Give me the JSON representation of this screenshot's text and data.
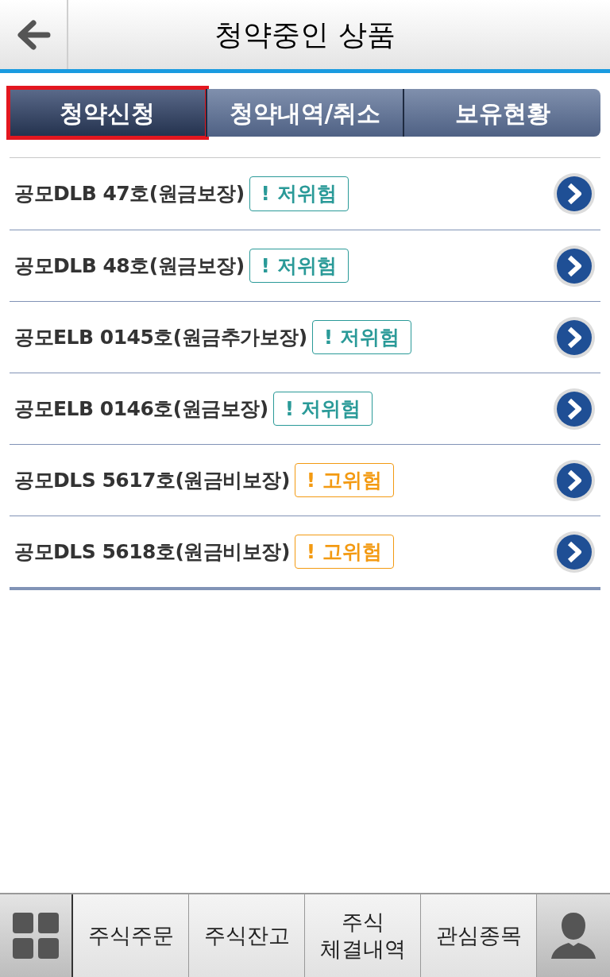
{
  "header": {
    "title": "청약중인 상품"
  },
  "tabs": [
    {
      "label": "청약신청",
      "selected": true
    },
    {
      "label": "청약내역/취소",
      "selected": false
    },
    {
      "label": "보유현황",
      "selected": false
    }
  ],
  "products": [
    {
      "name": "공모DLB 47호(원금보장)",
      "risk": {
        "kind": "low",
        "label": "! 저위험"
      }
    },
    {
      "name": "공모DLB 48호(원금보장)",
      "risk": {
        "kind": "low",
        "label": "! 저위험"
      }
    },
    {
      "name": "공모ELB 0145호(원금추가보장)",
      "risk": {
        "kind": "low",
        "label": "! 저위험"
      }
    },
    {
      "name": "공모ELB 0146호(원금보장)",
      "risk": {
        "kind": "low",
        "label": "! 저위험"
      }
    },
    {
      "name": "공모DLS 5617호(원금비보장)",
      "risk": {
        "kind": "high",
        "label": "! 고위험"
      }
    },
    {
      "name": "공모DLS 5618호(원금비보장)",
      "risk": {
        "kind": "high",
        "label": "! 고위험"
      }
    }
  ],
  "bottom_bar": {
    "items": [
      {
        "lines": [
          "주식주문"
        ]
      },
      {
        "lines": [
          "주식잔고"
        ]
      },
      {
        "lines": [
          "주식",
          "체결내역"
        ]
      },
      {
        "lines": [
          "관심종목"
        ]
      }
    ]
  }
}
